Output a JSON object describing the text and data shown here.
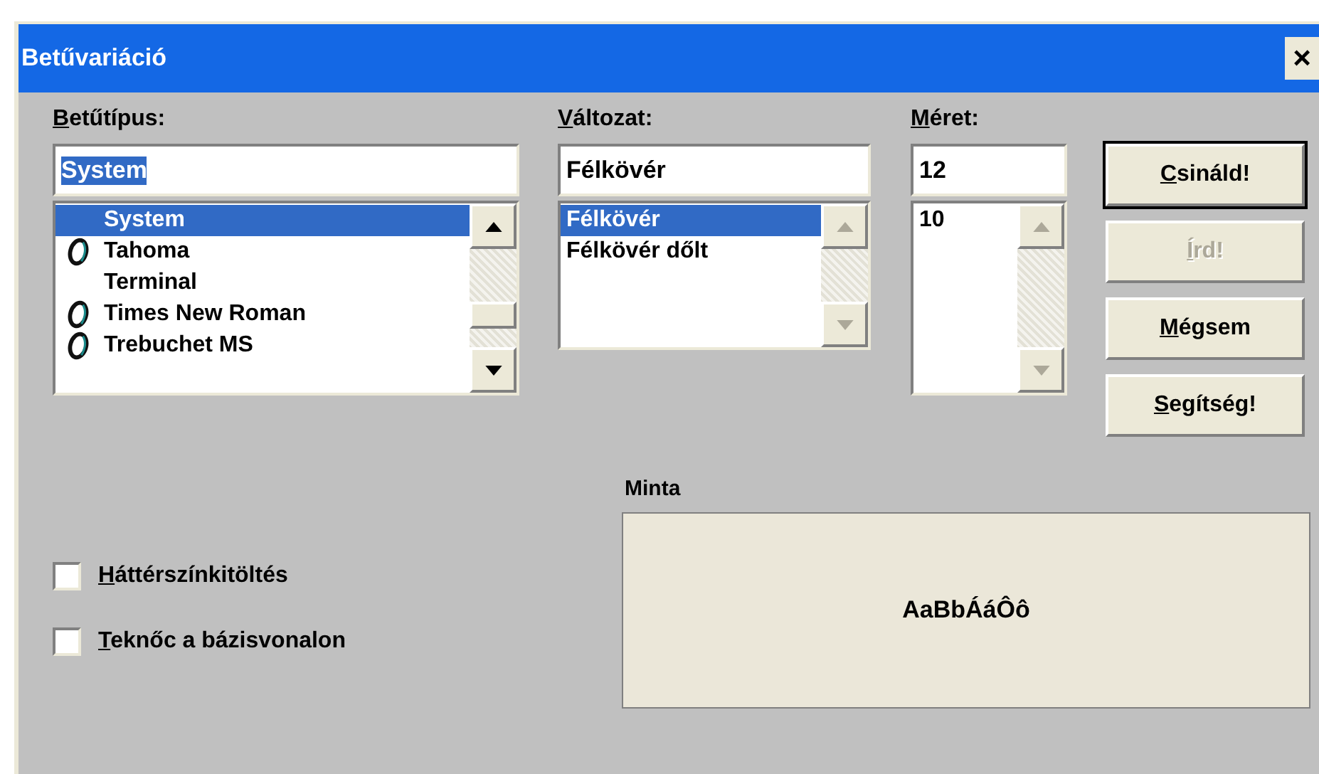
{
  "window": {
    "title": "Betűvariáció",
    "close": "×"
  },
  "font": {
    "label": "Betűtípus:",
    "value": "System",
    "value_selected": true,
    "items": [
      {
        "name": "System",
        "truetype": false,
        "selected": true
      },
      {
        "name": "Tahoma",
        "truetype": true,
        "selected": false
      },
      {
        "name": "Terminal",
        "truetype": false,
        "selected": false
      },
      {
        "name": "Times New Roman",
        "truetype": true,
        "selected": false
      },
      {
        "name": "Trebuchet MS",
        "truetype": true,
        "selected": false
      }
    ]
  },
  "style": {
    "label": "Változat:",
    "value": "Félkövér",
    "items": [
      {
        "name": "Félkövér",
        "selected": true
      },
      {
        "name": "Félkövér dőlt",
        "selected": false
      }
    ]
  },
  "size": {
    "label": "Méret:",
    "value": "12",
    "items": [
      {
        "name": "10",
        "selected": false
      }
    ]
  },
  "buttons": [
    {
      "label": "Csináld!",
      "default": true,
      "disabled": false
    },
    {
      "label": "Írd!",
      "default": false,
      "disabled": true
    },
    {
      "label": "Mégsem",
      "default": false,
      "disabled": false
    },
    {
      "label": "Segítség!",
      "default": false,
      "disabled": false
    }
  ],
  "options": [
    {
      "label": "Háttérszínkitöltés",
      "checked": false
    },
    {
      "label": "Teknőc a bázisvonalon",
      "checked": false
    }
  ],
  "sample": {
    "label": "Minta",
    "text": "AaBbÁáÔô"
  }
}
